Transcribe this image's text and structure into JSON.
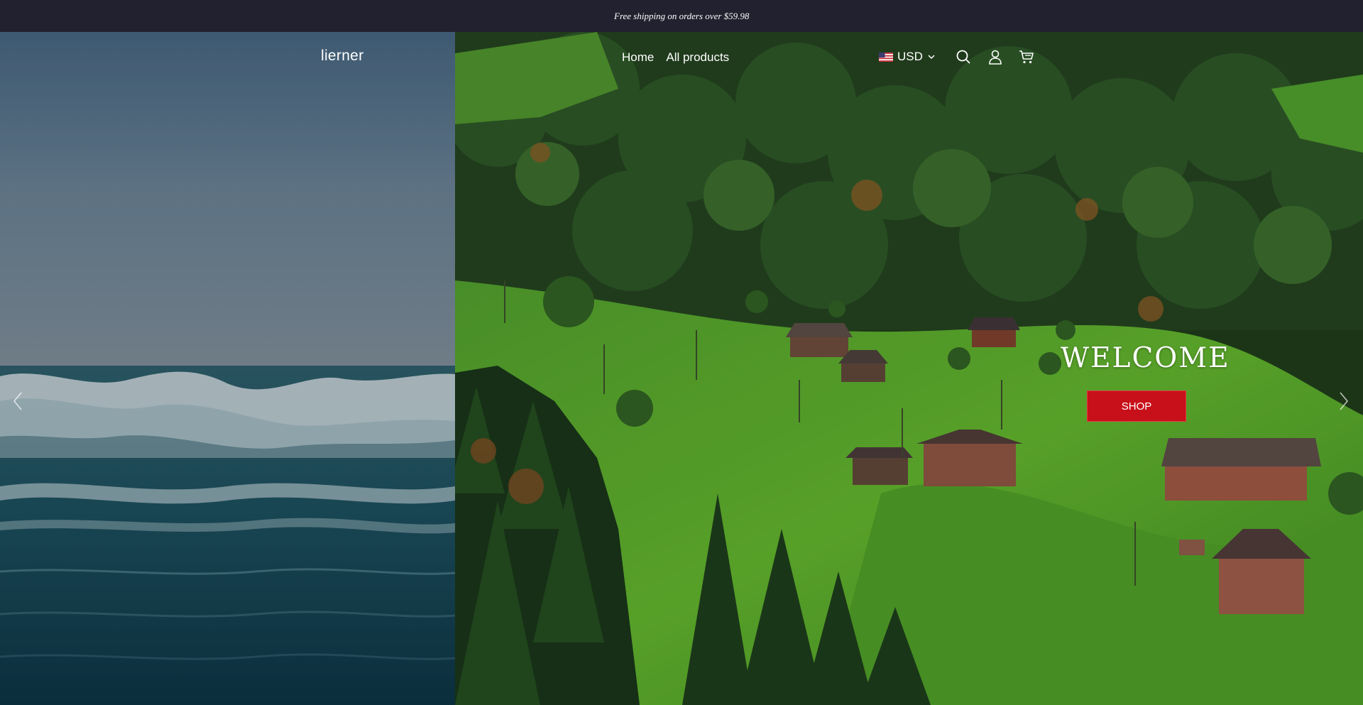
{
  "announcement": {
    "text": "Free shipping on orders over $59.98"
  },
  "header": {
    "logo": "lierner",
    "nav": [
      {
        "label": "Home"
      },
      {
        "label": "All products"
      }
    ],
    "currency": {
      "label": "USD",
      "flag": "us-flag-icon"
    },
    "icons": [
      "search-icon",
      "user-icon",
      "cart-icon"
    ]
  },
  "hero": {
    "title": "WELCOME",
    "button_label": "SHOP"
  },
  "colors": {
    "announcement_bg": "#22212f",
    "button_bg": "#c8101a",
    "text": "#ffffff"
  }
}
